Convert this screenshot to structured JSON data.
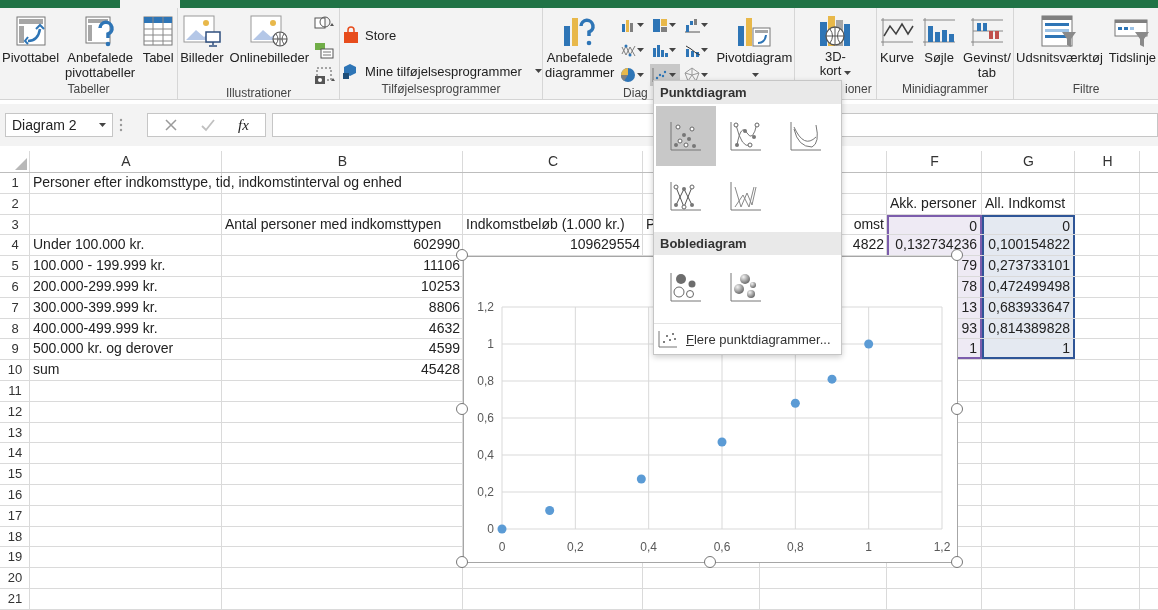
{
  "ribbon": {
    "groups": [
      {
        "kind": "tables",
        "label": "Tabeller",
        "buttons": [
          {
            "label": "Pivottabel",
            "dropdown": false
          },
          {
            "label": "Anbefalede pivottabeller",
            "dropdown": false
          },
          {
            "label": "Tabel",
            "dropdown": false
          }
        ]
      },
      {
        "kind": "illustrations",
        "label": "Illustrationer",
        "buttons": [
          {
            "label": "Billeder",
            "dropdown": false
          },
          {
            "label": "Onlinebilleder",
            "dropdown": false
          }
        ]
      },
      {
        "kind": "addins",
        "label": "Tilføjelsesprogrammer",
        "buttons": [
          {
            "label": "Store",
            "dropdown": false
          },
          {
            "label": "Mine tilføjelsesprogrammer",
            "dropdown": true
          }
        ]
      },
      {
        "kind": "charts",
        "label": "Diag",
        "buttons": [
          {
            "label": "Anbefalede diagrammer",
            "dropdown": false
          },
          {
            "label": "Pivotdiagram",
            "dropdown": true
          }
        ],
        "chart_buttons": [
          {
            "selected": false
          },
          {
            "selected": false
          },
          {
            "selected": false
          },
          {
            "selected": false
          },
          {
            "selected": false
          },
          {
            "selected": false
          },
          {
            "selected": false
          },
          {
            "selected": true
          },
          {
            "selected": false
          }
        ]
      },
      {
        "kind": "tours",
        "label": "ioner",
        "buttons": [
          {
            "label": "3D-kort",
            "dropdown": true
          }
        ]
      },
      {
        "kind": "sparklines",
        "label": "Minidiagrammer",
        "buttons": [
          {
            "label": "Kurve",
            "dropdown": false
          },
          {
            "label": "Søjle",
            "dropdown": false
          },
          {
            "label": "Gevinst/ tab",
            "dropdown": false
          }
        ]
      },
      {
        "kind": "filters",
        "label": "Filtre",
        "buttons": [
          {
            "label": "Udsnitsværktøj",
            "dropdown": false
          },
          {
            "label": "Tidslinje",
            "dropdown": false
          }
        ]
      }
    ]
  },
  "formula_bar": {
    "name_box": "Diagram 2",
    "function_label": "fx"
  },
  "sheet": {
    "columns": [
      {
        "label": "A"
      },
      {
        "label": "B"
      },
      {
        "label": "C"
      },
      {},
      {},
      {
        "label": "F"
      },
      {
        "label": "G"
      },
      {
        "label": "H"
      }
    ],
    "rows": [
      {
        "number": "1",
        "cells": [
          {
            "text": "Personer efter indkomsttype, tid, indkomstinterval og enhed",
            "kind": "label"
          }
        ]
      },
      {
        "number": "2",
        "cells": [
          {},
          {},
          {},
          {},
          {},
          {
            "text": "Akk. personer",
            "kind": "label"
          },
          {
            "text": "All. Indkomst",
            "kind": "label"
          }
        ]
      },
      {
        "number": "3",
        "cells": [
          {},
          {
            "text": "Antal personer med indkomsttypen",
            "kind": "label"
          },
          {
            "text": "Indkomstbeløb (1.000 kr.)",
            "kind": "label"
          },
          {
            "text": "P",
            "kind": "label"
          },
          {
            "text": "omst",
            "kind": "value"
          },
          {
            "text": "0",
            "kind": "value",
            "color": "#7c5dac"
          },
          {
            "text": "0",
            "kind": "value",
            "color": "#2f5597"
          }
        ]
      },
      {
        "number": "4",
        "cells": [
          {
            "text": "Under 100.000 kr.",
            "kind": "label"
          },
          {
            "text": "602990",
            "kind": "value"
          },
          {
            "text": "109629554",
            "kind": "value"
          },
          {},
          {
            "text": "4822",
            "kind": "value"
          },
          {
            "text": "0,132734236",
            "kind": "value",
            "color": "#7c5dac"
          },
          {
            "text": "0,100154822",
            "kind": "value",
            "color": "#2f5597"
          }
        ]
      },
      {
        "number": "5",
        "cells": [
          {
            "text": "100.000 - 199.999 kr.",
            "kind": "label"
          },
          {
            "text": "11106",
            "kind": "value"
          },
          {},
          {},
          {},
          {
            "text": "79",
            "kind": "value",
            "color": "#7c5dac"
          },
          {
            "text": "0,273733101",
            "kind": "value",
            "color": "#2f5597"
          }
        ]
      },
      {
        "number": "6",
        "cells": [
          {
            "text": "200.000-299.999 kr.",
            "kind": "label"
          },
          {
            "text": "10253",
            "kind": "value"
          },
          {},
          {},
          {},
          {
            "text": "78",
            "kind": "value",
            "color": "#7c5dac"
          },
          {
            "text": "0,472499498",
            "kind": "value",
            "color": "#2f5597"
          }
        ]
      },
      {
        "number": "7",
        "cells": [
          {
            "text": "300.000-399.999 kr.",
            "kind": "label"
          },
          {
            "text": "8806",
            "kind": "value"
          },
          {},
          {},
          {},
          {
            "text": "13",
            "kind": "value",
            "color": "#7c5dac"
          },
          {
            "text": "0,683933647",
            "kind": "value",
            "color": "#2f5597"
          }
        ]
      },
      {
        "number": "8",
        "cells": [
          {
            "text": "400.000-499.999 kr.",
            "kind": "label"
          },
          {
            "text": "4632",
            "kind": "value"
          },
          {},
          {},
          {},
          {
            "text": "93",
            "kind": "value",
            "color": "#7c5dac"
          },
          {
            "text": "0,814389828",
            "kind": "value",
            "color": "#2f5597"
          }
        ]
      },
      {
        "number": "9",
        "cells": [
          {
            "text": "500.000 kr. og derover",
            "kind": "label"
          },
          {
            "text": "4599",
            "kind": "value"
          },
          {},
          {},
          {},
          {
            "text": "1",
            "kind": "value",
            "color": "#7c5dac"
          },
          {
            "text": "1",
            "kind": "value",
            "color": "#2f5597"
          }
        ]
      },
      {
        "number": "10",
        "cells": [
          {
            "text": "sum",
            "kind": "label"
          },
          {
            "text": "45428",
            "kind": "value"
          }
        ]
      },
      {
        "number": "11"
      },
      {
        "number": "12"
      },
      {
        "number": "13"
      },
      {
        "number": "14"
      },
      {
        "number": "15"
      },
      {
        "number": "16"
      },
      {
        "number": "17"
      },
      {
        "number": "18"
      },
      {
        "number": "19"
      },
      {
        "number": "20"
      },
      {
        "number": "21"
      }
    ]
  },
  "chart": {
    "chart_data": {
      "type": "scatter",
      "grid": true,
      "x": [
        0,
        0.13,
        0.38,
        0.6,
        0.8,
        0.9,
        1
      ],
      "series": [
        {
          "color": "#5b9bd5",
          "values": [
            0,
            0.1,
            0.27,
            0.47,
            0.68,
            0.81,
            1
          ]
        }
      ],
      "xlim": [
        0,
        1.2
      ],
      "ylim": [
        0,
        1.2
      ],
      "xticks": [
        {
          "value": 0,
          "label": "0"
        },
        {
          "value": 0.2,
          "label": "0,2"
        },
        {
          "value": 0.4,
          "label": "0,4"
        },
        {
          "value": 0.6,
          "label": "0,6"
        },
        {
          "value": 0.8,
          "label": "0,8"
        },
        {
          "value": 1,
          "label": "1"
        },
        {
          "value": 1.2,
          "label": "1,2"
        }
      ],
      "yticks": [
        {
          "value": 0,
          "label": "0"
        },
        {
          "value": 0.2,
          "label": "0,2"
        },
        {
          "value": 0.4,
          "label": "0,4"
        },
        {
          "value": 0.6,
          "label": "0,6"
        },
        {
          "value": 0.8,
          "label": "0,8"
        },
        {
          "value": 1,
          "label": "1"
        },
        {
          "value": 1.2,
          "label": "1,2"
        }
      ]
    }
  },
  "chart_type_menu": {
    "sections": [
      {
        "title": "Punktdiagram",
        "items": [
          {
            "selected": true
          },
          {
            "selected": false
          },
          {
            "selected": false
          },
          {
            "selected": false
          },
          {
            "selected": false
          }
        ]
      },
      {
        "title": "Boblediagram",
        "items": [
          {
            "selected": false
          },
          {
            "selected": false
          }
        ]
      }
    ],
    "more_link": "Flere punktdiagrammer..."
  }
}
